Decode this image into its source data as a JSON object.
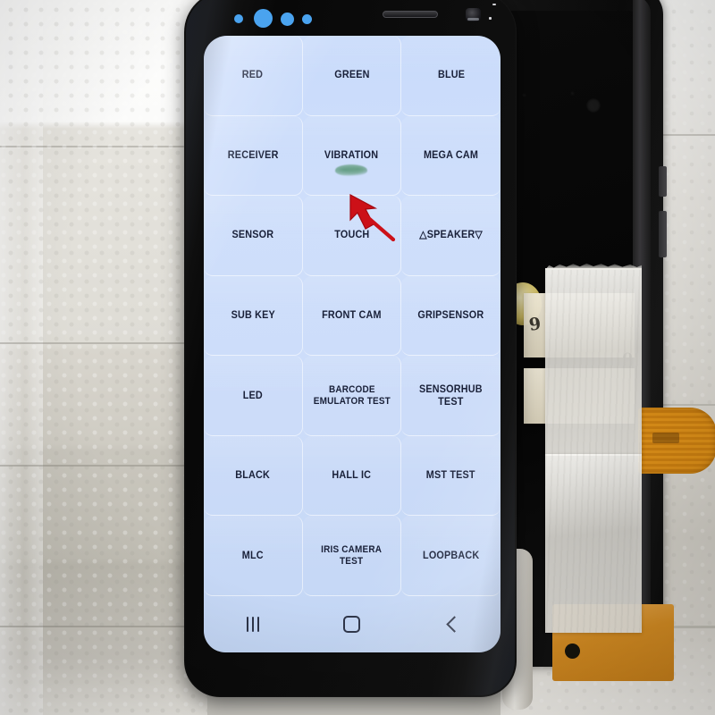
{
  "device": {
    "type": "smartphone",
    "screen_bg_color": "#ccdcf9",
    "label_text_color": "#192038",
    "bezel_color": "#101010"
  },
  "diagnostics_grid": {
    "columns": 3,
    "rows": 7,
    "cells": [
      {
        "label": "RED",
        "name": "test-red"
      },
      {
        "label": "GREEN",
        "name": "test-green"
      },
      {
        "label": "BLUE",
        "name": "test-blue"
      },
      {
        "label": "RECEIVER",
        "name": "test-receiver"
      },
      {
        "label": "VIBRATION",
        "name": "test-vibration"
      },
      {
        "label": "MEGA CAM",
        "name": "test-mega-cam"
      },
      {
        "label": "SENSOR",
        "name": "test-sensor"
      },
      {
        "label": "TOUCH",
        "name": "test-touch"
      },
      {
        "label": "△SPEAKER▽",
        "name": "test-speaker"
      },
      {
        "label": "SUB KEY",
        "name": "test-sub-key"
      },
      {
        "label": "FRONT CAM",
        "name": "test-front-cam"
      },
      {
        "label": "GRIPSENSOR",
        "name": "test-gripsensor"
      },
      {
        "label": "LED",
        "name": "test-led"
      },
      {
        "label": "BARCODE\nEMULATOR TEST",
        "name": "test-barcode-emulator"
      },
      {
        "label": "SENSORHUB TEST",
        "name": "test-sensorhub"
      },
      {
        "label": "BLACK",
        "name": "test-black"
      },
      {
        "label": "HALL IC",
        "name": "test-hall-ic"
      },
      {
        "label": "MST TEST",
        "name": "test-mst"
      },
      {
        "label": "MLC",
        "name": "test-mlc"
      },
      {
        "label": "IRIS CAMERA\nTEST",
        "name": "test-iris-camera"
      },
      {
        "label": "LOOPBACK",
        "name": "test-loopback"
      }
    ]
  },
  "navbar": {
    "recents_icon": "recents-icon",
    "home_icon": "home-icon",
    "back_icon": "back-icon"
  },
  "annotation": {
    "pointer_color": "#cc1018",
    "pointer_icon": "red-arrow-cursor",
    "points_at": "VIBRATION"
  },
  "hardware": {
    "earpiece": "earpiece-speaker",
    "front_camera": "front-camera-lens",
    "sensor_dots": 4,
    "sensor_dot_color": "#4aa3ef"
  }
}
